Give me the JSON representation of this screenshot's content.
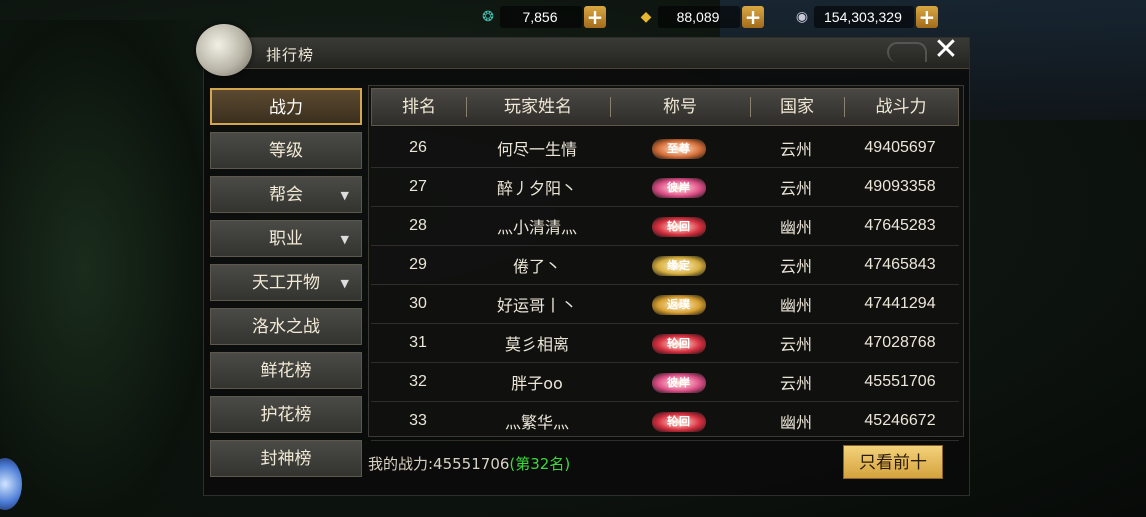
{
  "currencies": [
    {
      "icon": "jade-icon",
      "value": "7,856",
      "color": "#3fc2b0"
    },
    {
      "icon": "gold-ingot-icon",
      "value": "88,089",
      "color": "#e8b830"
    },
    {
      "icon": "silver-coin-icon",
      "value": "154,303,329",
      "color": "#c8c8d8"
    }
  ],
  "window": {
    "title": "排行榜",
    "close_glyph": "✕"
  },
  "nav": [
    {
      "label": "战力",
      "active": true,
      "has_arrow": false
    },
    {
      "label": "等级",
      "active": false,
      "has_arrow": false
    },
    {
      "label": "帮会",
      "active": false,
      "has_arrow": true
    },
    {
      "label": "职业",
      "active": false,
      "has_arrow": true
    },
    {
      "label": "天工开物",
      "active": false,
      "has_arrow": true
    },
    {
      "label": "洛水之战",
      "active": false,
      "has_arrow": false
    },
    {
      "label": "鲜花榜",
      "active": false,
      "has_arrow": false
    },
    {
      "label": "护花榜",
      "active": false,
      "has_arrow": false
    },
    {
      "label": "封神榜",
      "active": false,
      "has_arrow": false
    }
  ],
  "table": {
    "headers": [
      "排名",
      "玩家姓名",
      "称号",
      "国家",
      "战斗力"
    ],
    "rows": [
      {
        "rank": "26",
        "name": "何尽一生情",
        "title": "至尊",
        "title_color": "#d8703a",
        "country": "云州",
        "power": "49405697"
      },
      {
        "rank": "27",
        "name": "醉丿夕阳丶",
        "title": "彼岸",
        "title_color": "#e0508a",
        "country": "云州",
        "power": "49093358"
      },
      {
        "rank": "28",
        "name": "灬小清清灬",
        "title": "轮回",
        "title_color": "#d83040",
        "country": "幽州",
        "power": "47645283"
      },
      {
        "rank": "29",
        "name": "倦了丶",
        "title": "缘定",
        "title_color": "#d8b040",
        "country": "云州",
        "power": "47465843"
      },
      {
        "rank": "30",
        "name": "好运哥丨丶",
        "title": "返璞",
        "title_color": "#d8a030",
        "country": "幽州",
        "power": "47441294"
      },
      {
        "rank": "31",
        "name": "莫彡相离",
        "title": "轮回",
        "title_color": "#d83040",
        "country": "云州",
        "power": "47028768"
      },
      {
        "rank": "32",
        "name": "胖子oo",
        "title": "彼岸",
        "title_color": "#e0508a",
        "country": "云州",
        "power": "45551706"
      },
      {
        "rank": "33",
        "name": "灬繁华灬",
        "title": "轮回",
        "title_color": "#d83040",
        "country": "幽州",
        "power": "45246672"
      }
    ]
  },
  "footer": {
    "my_power_label": "我的战力:45551706",
    "my_rank": "(第32名)",
    "top10_button": "只看前十"
  }
}
